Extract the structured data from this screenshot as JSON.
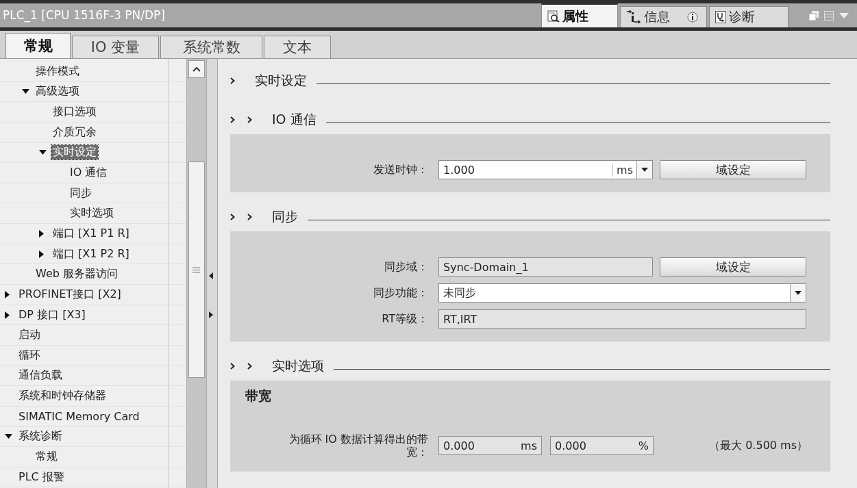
{
  "window": {
    "title": "PLC_1 [CPU 1516F-3 PN/DP]"
  },
  "inspector_tabs": [
    {
      "label": "属性",
      "kind": "properties",
      "selected": true
    },
    {
      "label": "信息",
      "kind": "info",
      "selected": false
    },
    {
      "label": "诊断",
      "kind": "diagnostics",
      "selected": false
    }
  ],
  "tabs": [
    {
      "label": "常规",
      "selected": true
    },
    {
      "label": "IO 变量",
      "selected": false
    },
    {
      "label": "系统常数",
      "selected": false
    },
    {
      "label": "文本",
      "selected": false
    }
  ],
  "tree": {
    "scrolled_parent_children": [
      {
        "label": "操作模式",
        "selected": false
      },
      {
        "label": "高级选项",
        "selected": false,
        "expanded": true,
        "children": [
          {
            "label": "接口选项",
            "selected": false
          },
          {
            "label": "介质冗余",
            "selected": false
          },
          {
            "label": "实时设定",
            "selected": true,
            "expanded": true,
            "children": [
              {
                "label": "IO 通信",
                "selected": false
              },
              {
                "label": "同步",
                "selected": false
              },
              {
                "label": "实时选项",
                "selected": false
              }
            ]
          },
          {
            "label": "端口 [X1 P1 R]",
            "selected": false,
            "expanded": false
          },
          {
            "label": "端口 [X1 P2 R]",
            "selected": false,
            "expanded": false
          }
        ]
      },
      {
        "label": "Web 服务器访问",
        "selected": false
      }
    ],
    "items": [
      {
        "label": "PROFINET接口 [X2]",
        "selected": false,
        "expanded": false
      },
      {
        "label": "DP 接口 [X3]",
        "selected": false,
        "expanded": false
      },
      {
        "label": "启动",
        "selected": false
      },
      {
        "label": "循环",
        "selected": false
      },
      {
        "label": "通信负载",
        "selected": false
      },
      {
        "label": "系统和时钟存储器",
        "selected": false
      },
      {
        "label": "SIMATIC Memory Card",
        "selected": false
      },
      {
        "label": "系统诊断",
        "selected": false,
        "expanded": true,
        "children": [
          {
            "label": "常规",
            "selected": false
          }
        ]
      },
      {
        "label": "PLC 报警",
        "selected": false
      }
    ]
  },
  "content": {
    "sections": [
      {
        "title": "实时设定",
        "children": [
          {
            "title": "IO 通信",
            "rows": [
              {
                "kind": "unit-dropdown",
                "label": "发送时钟：",
                "value": "1.000",
                "unit": "ms",
                "button": "域设定"
              }
            ]
          },
          {
            "title": "同步",
            "rows": [
              {
                "kind": "readonly",
                "label": "同步域：",
                "value": "Sync-Domain_1",
                "button": "域设定"
              },
              {
                "kind": "dropdown",
                "label": "同步功能：",
                "value": "未同步"
              },
              {
                "kind": "readonly",
                "label": "RT等级：",
                "value": "RT,IRT"
              }
            ]
          },
          {
            "title": "实时选项",
            "group": "带宽",
            "rows": [
              {
                "kind": "readouts",
                "label": "为循环 IO 数据计算得出的带宽：",
                "readouts": [
                  {
                    "value": "0.000",
                    "unit": "ms"
                  },
                  {
                    "value": "0.000",
                    "unit": "%"
                  }
                ],
                "note": "（最大 0.500 ms）"
              }
            ]
          }
        ]
      }
    ]
  }
}
